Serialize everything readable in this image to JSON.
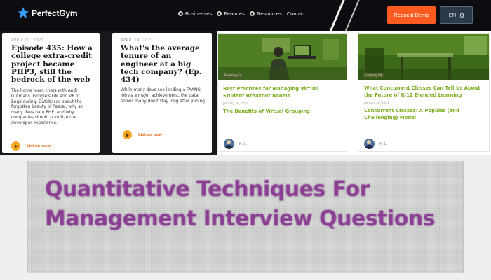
{
  "navbar": {
    "brand": "PerfectGym",
    "links": [
      {
        "label": "Businesses",
        "icon": "globe-icon"
      },
      {
        "label": "Features",
        "icon": "globe-icon"
      },
      {
        "label": "Resources",
        "icon": "globe-icon"
      },
      {
        "label": "Contact",
        "icon": null
      }
    ],
    "cta_label": "Request Demo",
    "lang_label": "EN",
    "colors": {
      "background": "#0b0d10",
      "cta": "#ff5a1f",
      "lang_bg": "#2b3a48"
    }
  },
  "podcasts": [
    {
      "date": "APRIL 22, 2022",
      "title": "Episode 435: How a college extra-credit project became PHP3, still the bedrock of the web",
      "description": "The home team chats with Andi Gutmans, Google's GM and VP of Engineering. Databases about the forgotten beauty of Pascal, why so many devs hate PHP, and why companies should prioritize the developer experience.",
      "listen_label": "Listen now"
    },
    {
      "date": "APRIL 19, 2022",
      "title": "What's the average tenure of an engineer at a big tech company? (Ep. 434)",
      "description": "While many devs see landing a FAANG job as a major achievement, the data shows many don't stay long after joining.",
      "listen_label": "Listen now"
    }
  ],
  "articles": [
    {
      "tag": "Evolving Ed",
      "title": "Best Practices for Managing Virtual Student Breakout Rooms",
      "date": "January 26, 2021",
      "subtitle": "The Benefits of Virtual Grouping",
      "author": "H. L."
    },
    {
      "tag": "Evolving Ed",
      "title": "What Concurrent Classes Can Tell Us About the Future of K-12 Blended Learning",
      "date": "January 26, 2021",
      "subtitle": "Concurrent Classes: A Popular (and Challenging) Model",
      "author": "H. L."
    }
  ],
  "banner": {
    "title": "Quantitative Techniques For Management Interview Questions",
    "colors": {
      "text": "#8a3e92",
      "background": "#d6d8d6"
    }
  }
}
